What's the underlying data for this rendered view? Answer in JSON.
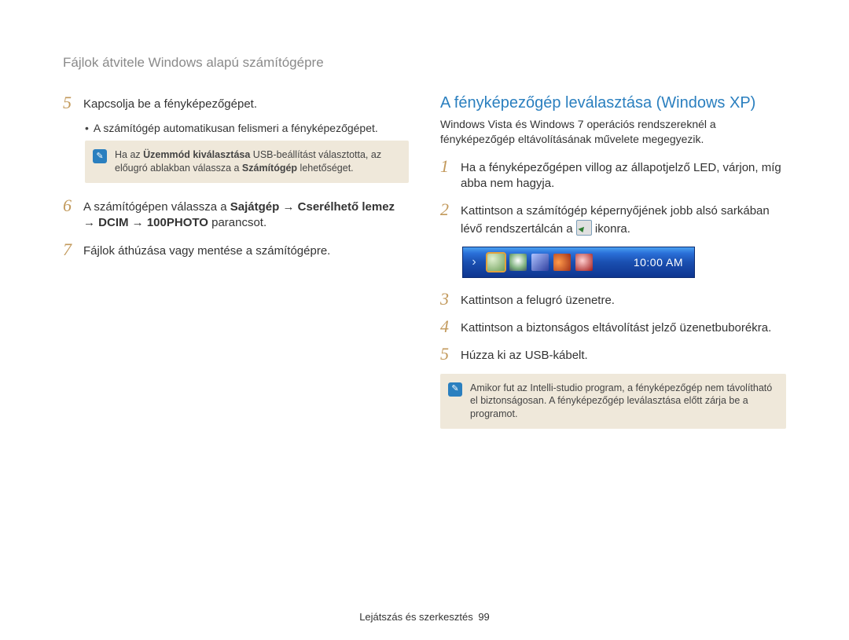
{
  "breadcrumb": "Fájlok átvitele Windows alapú számítógépre",
  "left": {
    "step5": {
      "num": "5",
      "text": "Kapcsolja be a fényképezőgépet.",
      "sub": "A számítógép automatikusan felismeri a fényképezőgépet."
    },
    "note1": {
      "text_pre": "Ha az ",
      "bold1": "Üzemmód kiválasztása",
      "text_mid": " USB-beállítást választotta, az előugró ablakban válassza a ",
      "bold2": "Számítógép",
      "text_post": " lehetőséget."
    },
    "step6": {
      "num": "6",
      "text_pre": "A számítógépen válassza a ",
      "bold1": "Sajátgép",
      "arrow1": " → ",
      "bold2": "Cserélhető lemez",
      "arrow2": " → ",
      "bold3": "DCIM",
      "arrow3": " → ",
      "bold4": "100PHOTO",
      "text_post": " parancsot."
    },
    "step7": {
      "num": "7",
      "text": "Fájlok áthúzása vagy mentése a számítógépre."
    }
  },
  "right": {
    "heading": "A fényképezőgép leválasztása (Windows XP)",
    "intro": "Windows Vista és Windows 7 operációs rendszereknél a fényképezőgép eltávolításának művelete megegyezik.",
    "step1": {
      "num": "1",
      "text": "Ha a fényképezőgépen villog az állapotjelző LED, várjon, míg abba nem hagyja."
    },
    "step2": {
      "num": "2",
      "text_pre": "Kattintson a számítógép képernyőjének jobb alsó sarkában lévő rendszertálcán a ",
      "text_post": " ikonra."
    },
    "systray_time": "10:00 AM",
    "step3": {
      "num": "3",
      "text": "Kattintson a felugró üzenetre."
    },
    "step4": {
      "num": "4",
      "text": "Kattintson a biztonságos eltávolítást jelző üzenetbuborékra."
    },
    "step5": {
      "num": "5",
      "text": "Húzza ki az USB-kábelt."
    },
    "note2": "Amikor fut az Intelli-studio program, a fényképezőgép nem távolítható el biztonságosan. A fényképezőgép leválasztása előtt zárja be a programot."
  },
  "footer": {
    "section": "Lejátszás és szerkesztés",
    "page": "99"
  }
}
